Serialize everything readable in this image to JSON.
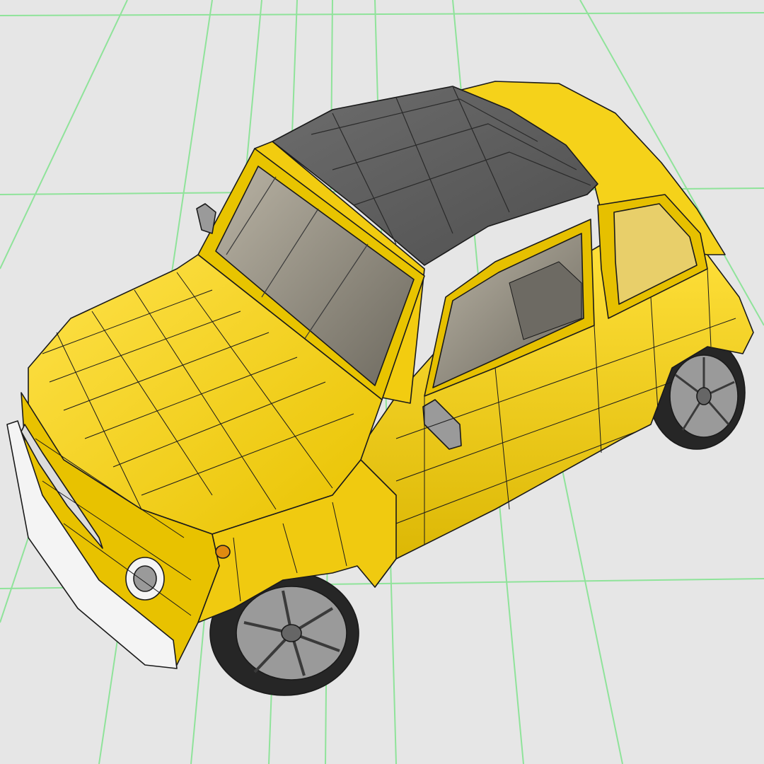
{
  "viewport": {
    "background": "#e6e6e6",
    "grid_color": "#8fe39a",
    "wireframe_color": "#1a1a1a"
  },
  "car": {
    "body_color": "#f5d21a",
    "body_shadow": "#c9a800",
    "roof_color": "#5f5f5f",
    "glass_color": "#9a8f7a",
    "chrome_color": "#f4f4f4",
    "tire_color": "#262626",
    "rim_color": "#9a9a9a",
    "indicator_color": "#e08a10"
  }
}
